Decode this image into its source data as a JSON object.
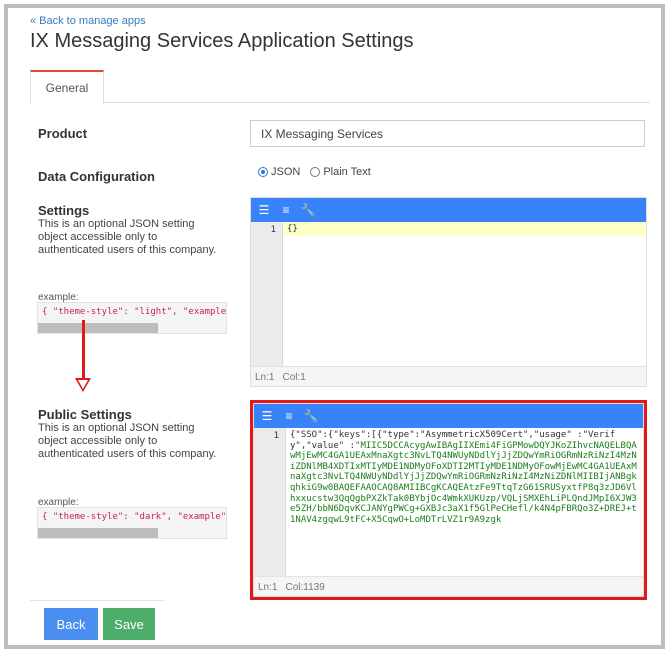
{
  "header": {
    "back_link": "« Back to manage apps",
    "title": "IX Messaging Services Application Settings"
  },
  "tabs": [
    {
      "label": "General"
    }
  ],
  "product": {
    "label": "Product",
    "value": "IX Messaging Services"
  },
  "data_configuration": {
    "label": "Data Configuration",
    "options": [
      {
        "label": "JSON",
        "selected": true
      },
      {
        "label": "Plain Text",
        "selected": false
      }
    ]
  },
  "settings": {
    "label": "Settings",
    "description": "This is an optional JSON setting object accessible only to authenticated users of this company.",
    "example_label": "example:",
    "example_code": "{ \"theme-style\": \"light\", \"example\"",
    "editor": {
      "line_number": "1",
      "content": "{}",
      "status_ln": "Ln:1",
      "status_col": "Col:1"
    }
  },
  "public_settings": {
    "label": "Public Settings",
    "description": "This is an optional JSON setting object accessible only to authenticated users of this company.",
    "example_label": "example:",
    "example_code": "{ \"theme-style\": \"dark\", \"example\":",
    "editor": {
      "line_number": "1",
      "content_head": "{\"SSO\":{\"keys\":[{\"type\":\"AsymmetricX509Cert\",\"usage\" :\"Verify\",\"value\" :",
      "content_value": "\"MIIC5DCCAcygAwIBAgIIXEmi4FiGPMowDQYJKoZIhvcNAQELBQAwMjEwMC4GA1UEAxMnaXgtc3NvLTQ4NWUyNDdlYjJjZDQwYmRiOGRmNzRiNzI4MzNiZDNlMB4XDTIxMTIyMDE1NDMyOFoXDTI2MTIyMDE1NDMyOFowMjEwMC4GA1UEAxMnaXgtc3NvLTQ4NWUyNDdlYjJjZDQwYmRiOGRmNzRiNzI4MzNiZDNlMIIBIjANBgkqhkiG9w0BAQEFAAOCAQ8AMIIBCgKCAQEAtzFe9TtqTzG61SRUSyxtfP8q3zJD6Vlhxxucstw3QqQgbPXZkTak0BYbjOc4WmkXUKUzp/VQLjSMXEhLiPLQndJMpI6XJW3e5ZH/bbN6DqvKCJANYgPWCg+GXBJc3aX1f5GlPeCHefl/k4N4pFBRQo3Z+DREJ+t1NAV4zgqwL9tFC+X5CqwO+LoMDTrLVZ1r9A9zgk",
      "status_ln": "Ln:1",
      "status_col": "Col:1139"
    }
  },
  "buttons": {
    "back": "Back",
    "save": "Save"
  },
  "colors": {
    "toolbar_blue": "#3883fa",
    "highlight_red": "#e01a1a",
    "back_button": "#4a8ef0",
    "save_button": "#4cae6a"
  }
}
